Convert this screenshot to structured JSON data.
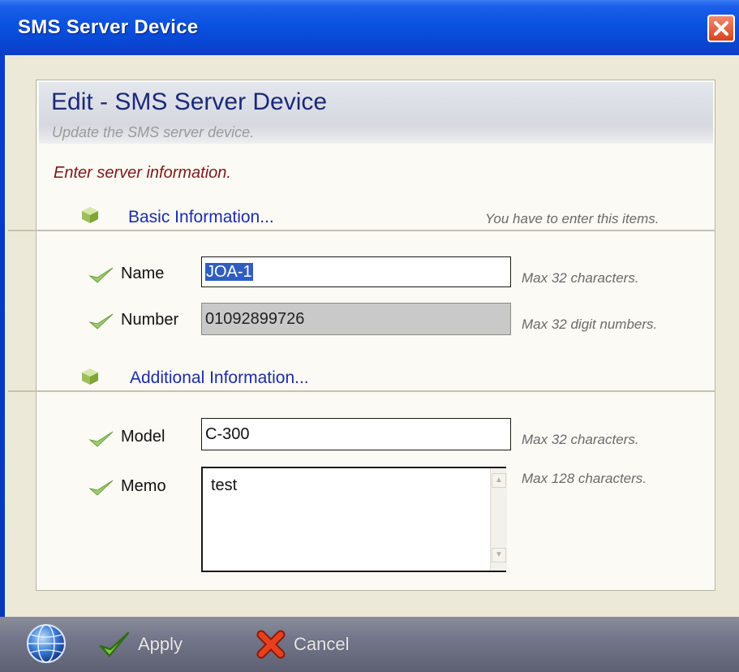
{
  "window": {
    "title": "SMS Server Device"
  },
  "header": {
    "title": "Edit - SMS Server Device",
    "subtitle": "Update the SMS server device."
  },
  "instruction": "Enter server information.",
  "sections": {
    "basic": {
      "title": "Basic Information...",
      "note": "You have to enter this items."
    },
    "additional": {
      "title": "Additional Information..."
    }
  },
  "fields": {
    "name": {
      "label": "Name",
      "value": "JOA-1",
      "hint": "Max 32 characters."
    },
    "number": {
      "label": "Number",
      "value": "01092899726",
      "hint": "Max 32 digit numbers."
    },
    "model": {
      "label": "Model",
      "value": "C-300",
      "hint": "Max 32 characters."
    },
    "memo": {
      "label": "Memo",
      "value": "test",
      "hint": "Max 128 characters."
    }
  },
  "footer": {
    "apply_label": "Apply",
    "cancel_label": "Cancel"
  },
  "colors": {
    "titlebar": "#0b52e0",
    "header_title": "#1a2a7a",
    "section_title": "#1a2ea8",
    "instruction": "#7a1a1a",
    "footer": "#73768a"
  },
  "icons": {
    "close": "close-icon",
    "section": "cube-icon",
    "field": "checkmark-icon",
    "app": "globe-icon",
    "apply": "checkmark-icon",
    "cancel": "x-icon"
  }
}
